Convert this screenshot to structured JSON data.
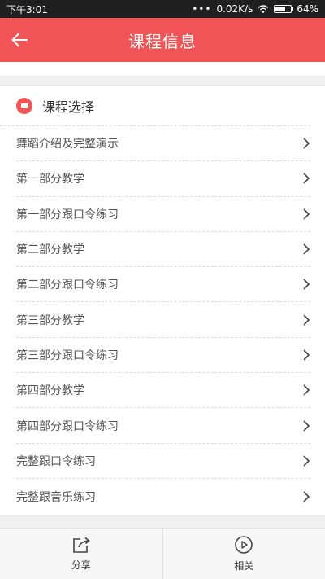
{
  "status_bar": {
    "time": "下午3:01",
    "network_speed": "0.02K/s",
    "battery": "64%"
  },
  "header": {
    "title": "课程信息"
  },
  "section": {
    "title": "课程选择"
  },
  "courses": [
    {
      "label": "舞蹈介绍及完整演示"
    },
    {
      "label": "第一部分教学"
    },
    {
      "label": "第一部分跟口令练习"
    },
    {
      "label": "第二部分教学"
    },
    {
      "label": "第二部分跟口令练习"
    },
    {
      "label": "第三部分教学"
    },
    {
      "label": "第三部分跟口令练习"
    },
    {
      "label": "第四部分教学"
    },
    {
      "label": "第四部分跟口令练习"
    },
    {
      "label": "完整跟口令练习"
    },
    {
      "label": "完整跟音乐练习"
    }
  ],
  "bottom_tabs": [
    {
      "label": "分享",
      "icon": "share-icon"
    },
    {
      "label": "相关",
      "icon": "play-circle-icon"
    }
  ],
  "colors": {
    "accent": "#f05456"
  }
}
